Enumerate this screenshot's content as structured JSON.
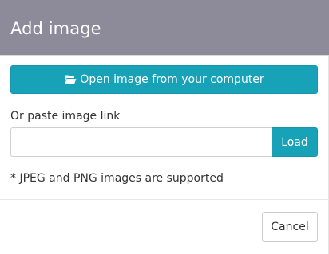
{
  "dialog": {
    "title": "Add image",
    "open_button": {
      "icon": "folder-open-icon",
      "label": "Open image from your computer"
    },
    "link_section": {
      "label": "Or paste image link",
      "input_value": "",
      "input_placeholder": "",
      "load_label": "Load"
    },
    "note": "* JPEG and PNG images are supported",
    "footer": {
      "cancel_label": "Cancel"
    }
  },
  "colors": {
    "header_bg": "#8d8a9a",
    "accent": "#17a2b8"
  }
}
